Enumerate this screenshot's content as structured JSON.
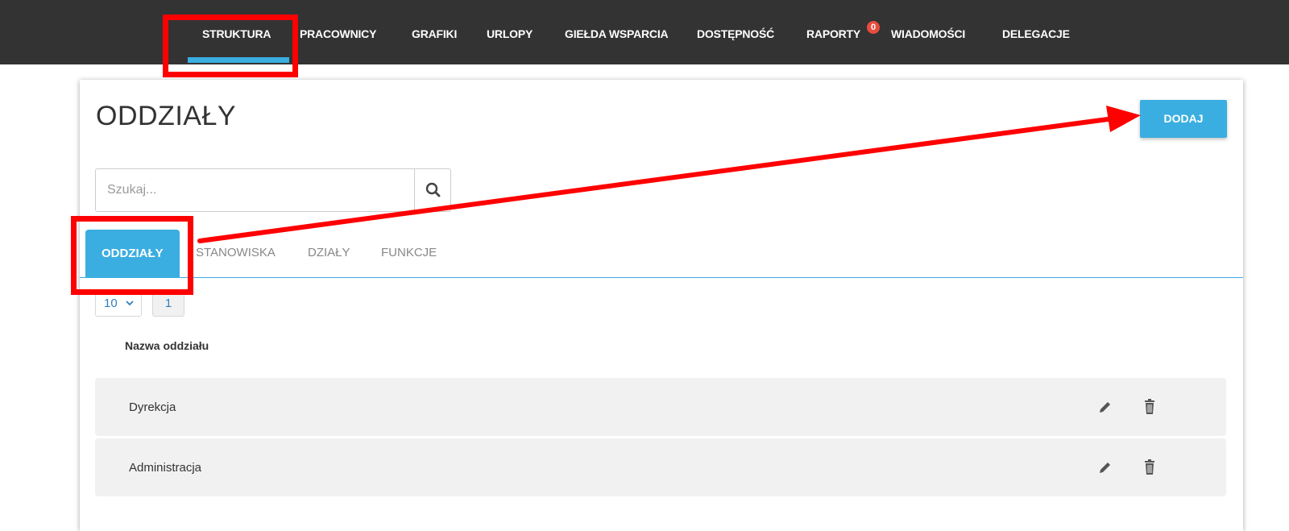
{
  "nav": {
    "items": [
      {
        "label": "STRUKTURA"
      },
      {
        "label": "PRACOWNICY"
      },
      {
        "label": "GRAFIKI"
      },
      {
        "label": "URLOPY"
      },
      {
        "label": "GIEŁDA WSPARCIA"
      },
      {
        "label": "DOSTĘPNOŚĆ"
      },
      {
        "label": "RAPORTY",
        "badge": "0"
      },
      {
        "label": "WIADOMOŚCI"
      },
      {
        "label": "DELEGACJE"
      }
    ],
    "active": "STRUKTURA"
  },
  "page": {
    "title": "ODDZIAŁY",
    "add_button": "DODAJ"
  },
  "search": {
    "placeholder": "Szukaj..."
  },
  "tabs": [
    {
      "label": "ODDZIAŁY",
      "active": true
    },
    {
      "label": "STANOWISKA"
    },
    {
      "label": "DZIAŁY"
    },
    {
      "label": "FUNKCJE"
    }
  ],
  "pagination": {
    "page_size": "10",
    "current_page": "1"
  },
  "table": {
    "column_header": "Nazwa oddziału",
    "rows": [
      {
        "name": "Dyrekcja"
      },
      {
        "name": "Administracja"
      }
    ]
  },
  "colors": {
    "topbar": "#333333",
    "accent": "#3aaee0",
    "annotation": "#ff0000",
    "badge": "#e84c3d"
  },
  "icons": [
    "search-icon",
    "chevron-down-icon",
    "pencil-icon",
    "trash-icon"
  ]
}
